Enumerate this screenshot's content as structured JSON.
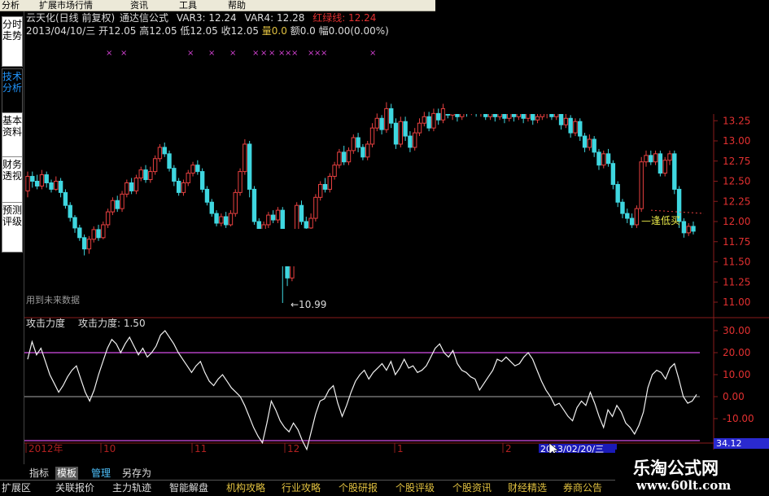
{
  "menu": [
    "分析",
    "扩展市场行情",
    "资讯",
    "工具",
    "帮助"
  ],
  "side_tabs": [
    {
      "label": "分时走势",
      "active": false
    },
    {
      "label": "技术分析",
      "active": true
    },
    {
      "label": "基本资料",
      "active": false
    },
    {
      "label": "财务透视",
      "active": false
    },
    {
      "label": "预测评级",
      "active": false
    }
  ],
  "header": {
    "title": "云天化(日线 前复权)",
    "formula": "通达信公式",
    "var3": "VAR3: 12.24",
    "var4": "VAR4: 12.28",
    "red_green": "红绿线: 12.24",
    "date": "2013/04/10/三",
    "open": "开12.05",
    "high": "高12.05",
    "low": "低12.05",
    "close": "收12.05",
    "vol": "量0.0",
    "amount": "额0.0",
    "range": "幅0.00(0.00%)",
    "cross_mark": "×"
  },
  "main_chart": {
    "future_data_label": "用到未来数据",
    "low_marker": "←10.99",
    "signal_label": "—逢低买",
    "yticks": [
      "13.25",
      "13.00",
      "12.75",
      "12.50",
      "12.25",
      "12.00",
      "11.75",
      "11.50",
      "11.25",
      "11.00"
    ]
  },
  "indicator": {
    "title": "攻击力度",
    "value_label": "攻击力度: 1.50",
    "yticks": [
      "30.00",
      "20.00",
      "10.00",
      "0.00",
      "-10.00"
    ],
    "axis_marker": "34.12"
  },
  "chart_data": {
    "type": "candlestick",
    "instrument": "云天化",
    "price_axis_ticks": [
      13.25,
      13.0,
      12.75,
      12.5,
      12.25,
      12.0,
      11.75,
      11.5,
      11.25,
      11.0
    ],
    "indicator_axis_ticks": [
      30,
      20,
      10,
      0,
      -10
    ],
    "indicator_reference_lines": [
      20,
      -20,
      0
    ],
    "annotated_low": 10.99,
    "candles": [
      [
        12.38,
        12.56,
        12.62,
        12.3
      ],
      [
        12.56,
        12.5,
        12.62,
        12.42
      ],
      [
        12.5,
        12.44,
        12.58,
        12.4
      ],
      [
        12.44,
        12.58,
        12.64,
        12.4
      ],
      [
        12.58,
        12.48,
        12.62,
        12.42
      ],
      [
        12.48,
        12.4,
        12.52,
        12.36
      ],
      [
        12.4,
        12.5,
        12.56,
        12.38
      ],
      [
        12.5,
        12.36,
        12.54,
        12.3
      ],
      [
        12.36,
        12.2,
        12.4,
        12.16
      ],
      [
        12.2,
        12.05,
        12.24,
        12.0
      ],
      [
        12.05,
        11.92,
        12.08,
        11.86
      ],
      [
        11.92,
        11.8,
        11.96,
        11.76
      ],
      [
        11.8,
        11.66,
        11.84,
        11.58
      ],
      [
        11.66,
        11.78,
        11.82,
        11.6
      ],
      [
        11.78,
        11.9,
        11.94,
        11.74
      ],
      [
        11.9,
        11.8,
        11.96,
        11.76
      ],
      [
        11.8,
        11.96,
        12.0,
        11.78
      ],
      [
        11.96,
        12.12,
        12.16,
        11.92
      ],
      [
        12.12,
        12.26,
        12.3,
        12.08
      ],
      [
        12.26,
        12.16,
        12.32,
        12.12
      ],
      [
        12.16,
        12.34,
        12.38,
        12.12
      ],
      [
        12.34,
        12.48,
        12.52,
        12.3
      ],
      [
        12.48,
        12.38,
        12.54,
        12.34
      ],
      [
        12.38,
        12.54,
        12.58,
        12.34
      ],
      [
        12.54,
        12.64,
        12.68,
        12.5
      ],
      [
        12.64,
        12.52,
        12.7,
        12.48
      ],
      [
        12.52,
        12.62,
        12.68,
        12.48
      ],
      [
        12.62,
        12.78,
        12.82,
        12.58
      ],
      [
        12.78,
        12.92,
        12.96,
        12.74
      ],
      [
        12.92,
        12.84,
        12.98,
        12.8
      ],
      [
        12.84,
        12.66,
        12.88,
        12.62
      ],
      [
        12.66,
        12.5,
        12.7,
        12.44
      ],
      [
        12.5,
        12.36,
        12.54,
        12.32
      ],
      [
        12.36,
        12.48,
        12.52,
        12.32
      ],
      [
        12.48,
        12.6,
        12.64,
        12.44
      ],
      [
        12.6,
        12.7,
        12.74,
        12.56
      ],
      [
        12.7,
        12.62,
        12.76,
        12.58
      ],
      [
        12.62,
        12.4,
        12.66,
        12.36
      ],
      [
        12.4,
        12.24,
        12.44,
        12.2
      ],
      [
        12.24,
        12.1,
        12.28,
        12.06
      ],
      [
        12.1,
        11.98,
        12.14,
        11.94
      ],
      [
        11.98,
        12.06,
        12.1,
        11.94
      ],
      [
        12.06,
        11.96,
        12.12,
        11.92
      ],
      [
        11.96,
        12.1,
        12.14,
        11.94
      ],
      [
        12.1,
        12.36,
        12.4,
        12.06
      ],
      [
        12.36,
        12.62,
        12.66,
        12.32
      ],
      [
        12.62,
        12.96,
        13.02,
        12.58
      ],
      [
        12.96,
        12.4,
        13.0,
        12.3
      ],
      [
        12.4,
        12.0,
        12.44,
        11.96
      ],
      [
        12.0,
        11.86,
        12.04,
        11.82
      ],
      [
        11.86,
        11.96,
        12.0,
        11.82
      ],
      [
        11.96,
        12.08,
        12.12,
        11.92
      ],
      [
        12.08,
        12.02,
        12.14,
        11.98
      ],
      [
        12.02,
        12.14,
        12.18,
        11.98
      ],
      [
        12.14,
        11.6,
        12.18,
        10.99
      ],
      [
        11.6,
        11.3,
        11.66,
        11.2
      ],
      [
        11.3,
        11.54,
        11.6,
        11.26
      ],
      [
        11.54,
        12.2,
        12.24,
        11.5
      ],
      [
        12.2,
        12.0,
        12.26,
        11.96
      ],
      [
        12.0,
        11.92,
        12.06,
        11.88
      ],
      [
        11.92,
        12.04,
        12.1,
        11.88
      ],
      [
        12.04,
        12.3,
        12.34,
        12.0
      ],
      [
        12.3,
        12.46,
        12.5,
        12.26
      ],
      [
        12.46,
        12.4,
        12.54,
        12.36
      ],
      [
        12.4,
        12.56,
        12.6,
        12.36
      ],
      [
        12.56,
        12.7,
        12.74,
        12.52
      ],
      [
        12.7,
        12.86,
        12.9,
        12.66
      ],
      [
        12.86,
        12.74,
        12.94,
        12.7
      ],
      [
        12.74,
        12.88,
        12.92,
        12.7
      ],
      [
        12.88,
        13.04,
        13.08,
        12.84
      ],
      [
        13.04,
        12.92,
        13.1,
        12.86
      ],
      [
        12.92,
        12.8,
        12.96,
        12.76
      ],
      [
        12.8,
        12.96,
        13.0,
        12.76
      ],
      [
        12.96,
        13.16,
        13.22,
        12.92
      ],
      [
        13.16,
        13.28,
        13.34,
        13.12
      ],
      [
        13.28,
        13.14,
        13.32,
        13.08
      ],
      [
        13.14,
        13.4,
        13.48,
        13.1
      ],
      [
        13.4,
        13.22,
        13.46,
        13.16
      ],
      [
        13.22,
        12.96,
        13.28,
        12.9
      ],
      [
        12.96,
        13.24,
        13.3,
        12.92
      ],
      [
        13.24,
        13.06,
        13.3,
        13.0
      ],
      [
        13.06,
        12.92,
        13.12,
        12.86
      ],
      [
        12.92,
        13.1,
        13.16,
        12.88
      ],
      [
        13.1,
        13.22,
        13.28,
        13.06
      ],
      [
        13.22,
        13.3,
        13.36,
        13.18
      ],
      [
        13.3,
        13.16,
        13.36,
        13.12
      ],
      [
        13.16,
        13.34,
        13.4,
        13.12
      ],
      [
        13.34,
        13.26,
        13.4,
        13.2
      ],
      [
        13.26,
        13.4,
        13.46,
        13.22
      ],
      [
        13.4,
        13.32,
        13.46,
        13.28
      ],
      [
        13.32,
        13.38,
        13.44,
        13.26
      ],
      [
        13.38,
        13.3,
        13.44,
        13.24
      ],
      [
        13.3,
        13.42,
        13.48,
        13.26
      ],
      [
        13.42,
        13.36,
        13.48,
        13.3
      ],
      [
        13.36,
        13.44,
        13.5,
        13.32
      ],
      [
        13.44,
        13.34,
        13.5,
        13.3
      ],
      [
        13.34,
        13.4,
        13.46,
        13.3
      ],
      [
        13.4,
        13.3,
        13.44,
        13.26
      ],
      [
        13.3,
        13.38,
        13.44,
        13.26
      ],
      [
        13.38,
        13.3,
        13.44,
        13.24
      ],
      [
        13.3,
        13.36,
        13.42,
        13.26
      ],
      [
        13.36,
        13.28,
        13.4,
        13.22
      ],
      [
        13.28,
        13.36,
        13.42,
        13.24
      ],
      [
        13.36,
        13.3,
        13.42,
        13.24
      ],
      [
        13.3,
        13.38,
        13.44,
        13.26
      ],
      [
        13.38,
        13.28,
        13.42,
        13.22
      ],
      [
        13.28,
        13.34,
        13.4,
        13.24
      ],
      [
        13.34,
        13.26,
        13.38,
        13.2
      ],
      [
        13.26,
        13.3,
        13.36,
        13.22
      ],
      [
        13.3,
        13.34,
        13.4,
        13.26
      ],
      [
        13.34,
        13.36,
        13.42,
        13.28
      ],
      [
        13.36,
        13.3,
        13.4,
        13.26
      ],
      [
        13.3,
        13.36,
        13.42,
        13.26
      ],
      [
        13.36,
        13.2,
        13.4,
        13.14
      ],
      [
        13.2,
        13.28,
        13.34,
        13.16
      ],
      [
        13.28,
        13.1,
        13.32,
        13.04
      ],
      [
        13.1,
        13.24,
        13.28,
        13.06
      ],
      [
        13.24,
        13.06,
        13.28,
        13.0
      ],
      [
        13.06,
        12.92,
        13.1,
        12.86
      ],
      [
        12.92,
        13.02,
        13.08,
        12.88
      ],
      [
        13.02,
        12.86,
        13.06,
        12.8
      ],
      [
        12.86,
        12.7,
        12.9,
        12.64
      ],
      [
        12.7,
        12.84,
        12.88,
        12.66
      ],
      [
        12.84,
        12.72,
        12.9,
        12.68
      ],
      [
        12.72,
        12.46,
        12.76,
        12.4
      ],
      [
        12.46,
        12.24,
        12.5,
        12.18
      ],
      [
        12.24,
        12.1,
        12.28,
        12.04
      ],
      [
        12.1,
        12.04,
        12.16,
        11.98
      ],
      [
        12.04,
        11.96,
        12.1,
        11.92
      ],
      [
        11.96,
        12.16,
        12.2,
        11.92
      ],
      [
        12.16,
        12.74,
        12.8,
        12.12
      ],
      [
        12.74,
        12.82,
        12.88,
        12.68
      ],
      [
        12.82,
        12.74,
        12.88,
        12.7
      ],
      [
        12.74,
        12.84,
        12.88,
        12.7
      ],
      [
        12.84,
        12.6,
        12.88,
        12.56
      ],
      [
        12.6,
        12.76,
        12.8,
        12.56
      ],
      [
        12.76,
        12.84,
        12.88,
        12.7
      ],
      [
        12.84,
        12.4,
        12.88,
        12.34
      ],
      [
        12.4,
        12.0,
        12.44,
        11.92
      ],
      [
        12.0,
        11.86,
        12.04,
        11.8
      ],
      [
        11.86,
        11.94,
        11.98,
        11.82
      ],
      [
        11.94,
        11.88,
        12.0,
        11.84
      ]
    ],
    "indicator_series": [
      17,
      25,
      19,
      22,
      16,
      10,
      6,
      2,
      5,
      9,
      12,
      14,
      8,
      2,
      -2,
      3,
      10,
      16,
      22,
      26,
      24,
      20,
      24,
      27,
      23,
      19,
      22,
      18,
      20,
      23,
      28,
      30,
      27,
      24,
      20,
      17,
      14,
      11,
      14,
      16,
      11,
      7,
      5,
      8,
      10,
      7,
      4,
      2,
      0,
      -4,
      -9,
      -14,
      -18,
      -21,
      -12,
      -2,
      -6,
      -11,
      -14,
      -16,
      -12,
      -15,
      -20,
      -24,
      -16,
      -8,
      -2,
      -1,
      3,
      5,
      -3,
      -9,
      -4,
      2,
      7,
      10,
      12,
      8,
      11,
      13,
      15,
      12,
      16,
      10,
      13,
      17,
      13,
      14,
      11,
      12,
      14,
      18,
      22,
      24,
      20,
      18,
      21,
      15,
      12,
      11,
      9,
      8,
      3,
      6,
      9,
      12,
      17,
      16,
      18,
      16,
      14,
      15,
      18,
      20,
      17,
      12,
      7,
      3,
      0,
      -4,
      -3,
      -6,
      -9,
      -11,
      -5,
      -2,
      -4,
      2,
      -3,
      -9,
      -14,
      -6,
      -9,
      -4,
      -7,
      -12,
      -14,
      -17,
      -13,
      -7,
      4,
      10,
      12,
      11,
      8,
      13,
      15,
      8,
      0,
      -3,
      -2,
      1
    ]
  }
}
